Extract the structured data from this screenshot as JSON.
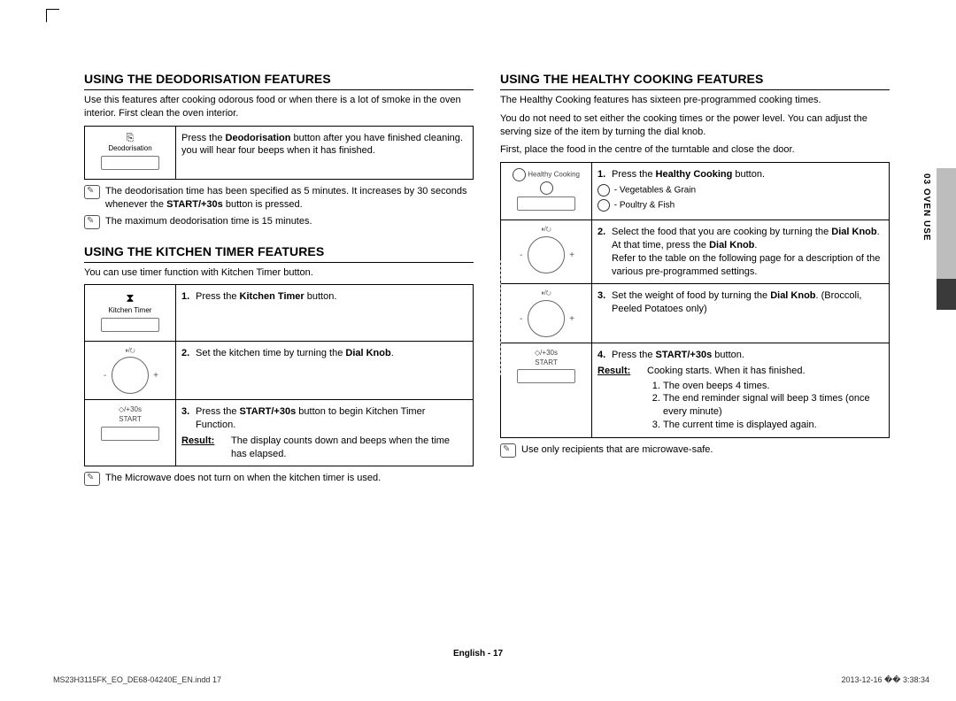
{
  "side_section": "03  OVEN USE",
  "left": {
    "h1": "USING THE DEODORISATION FEATURES",
    "p1": "Use this features after cooking odorous food or when there is a lot of smoke in the oven interior. First clean the oven interior.",
    "t1": {
      "icon_label": "Deodorisation",
      "text_a": "Press the ",
      "bold_a": "Deodorisation",
      "text_b": " button after you have finished cleaning. you will hear four beeps when it has finished."
    },
    "note1_a": "The deodorisation time has been specified as 5 minutes. It increases by 30 seconds whenever the ",
    "note1_bold": "START/+30s",
    "note1_b": " button is pressed.",
    "note2": "The maximum deodorisation time is 15 minutes.",
    "h2": "USING THE KITCHEN TIMER FEATURES",
    "p2": "You can use timer function with Kitchen Timer button.",
    "t2": {
      "r1_label": "Kitchen Timer",
      "r1_n": "1.",
      "r1_a": "Press the ",
      "r1_bold": "Kitchen Timer",
      "r1_b": " button.",
      "r2_n": "2.",
      "r2_a": "Set the kitchen time by turning the ",
      "r2_bold": "Dial Knob",
      "r2_b": ".",
      "r3_label_top": "+30s",
      "r3_label_bot": "START",
      "r3_n": "3.",
      "r3_a": "Press the ",
      "r3_bold": "START/+30s",
      "r3_b": " button to begin Kitchen Timer Function.",
      "r3_result_label": "Result:",
      "r3_result_text": "The display counts down and beeps when the time has elapsed."
    },
    "note3": "The Microwave does not turn on when the kitchen timer is used."
  },
  "right": {
    "h1": "USING THE HEALTHY COOKING FEATURES",
    "p1": "The Healthy Cooking features has sixteen pre-programmed cooking times.",
    "p2": "You do not need to set either the cooking times or the power level. You can adjust the serving size of the item by turning the dial knob.",
    "p3": "First, place the food in the centre of the turntable and close the door.",
    "t1": {
      "r1_label": "Healthy Cooking",
      "r1_n": "1.",
      "r1_a": "Press the ",
      "r1_bold": "Healthy Cooking",
      "r1_b": " button.",
      "r1_sub1": " - Vegetables & Grain",
      "r1_sub2": " - Poultry & Fish",
      "r2_n": "2.",
      "r2_a": "Select the food that you are cooking by turning the ",
      "r2_bold": "Dial Knob",
      "r2_b": ".",
      "r2_c": "At that time, press the ",
      "r2_bold2": "Dial Knob",
      "r2_d": ".",
      "r2_e": "Refer to the table on the following page for a description of the various pre-programmed settings.",
      "r3_n": "3.",
      "r3_a": "Set the weight of food by turning the ",
      "r3_bold": "Dial Knob",
      "r3_b": ". (Broccoli, Peeled Potatoes only)",
      "r4_label_top": "+30s",
      "r4_label_bot": "START",
      "r4_n": "4.",
      "r4_a": "Press the ",
      "r4_bold": "START/+30s",
      "r4_b": " button.",
      "r4_result_label": "Result:",
      "r4_result_text": "Cooking starts. When it has finished.",
      "r4_li1": "The oven beeps 4 times.",
      "r4_li2": "The end reminder signal will beep 3 times (once every minute)",
      "r4_li3": "The current time is displayed again."
    },
    "note1": "Use only recipients that are microwave-safe."
  },
  "page_num": "English - 17",
  "footer_left": "MS23H3115FK_EO_DE68-04240E_EN.indd   17",
  "footer_right": "2013-12-16   �� 3:38:34"
}
